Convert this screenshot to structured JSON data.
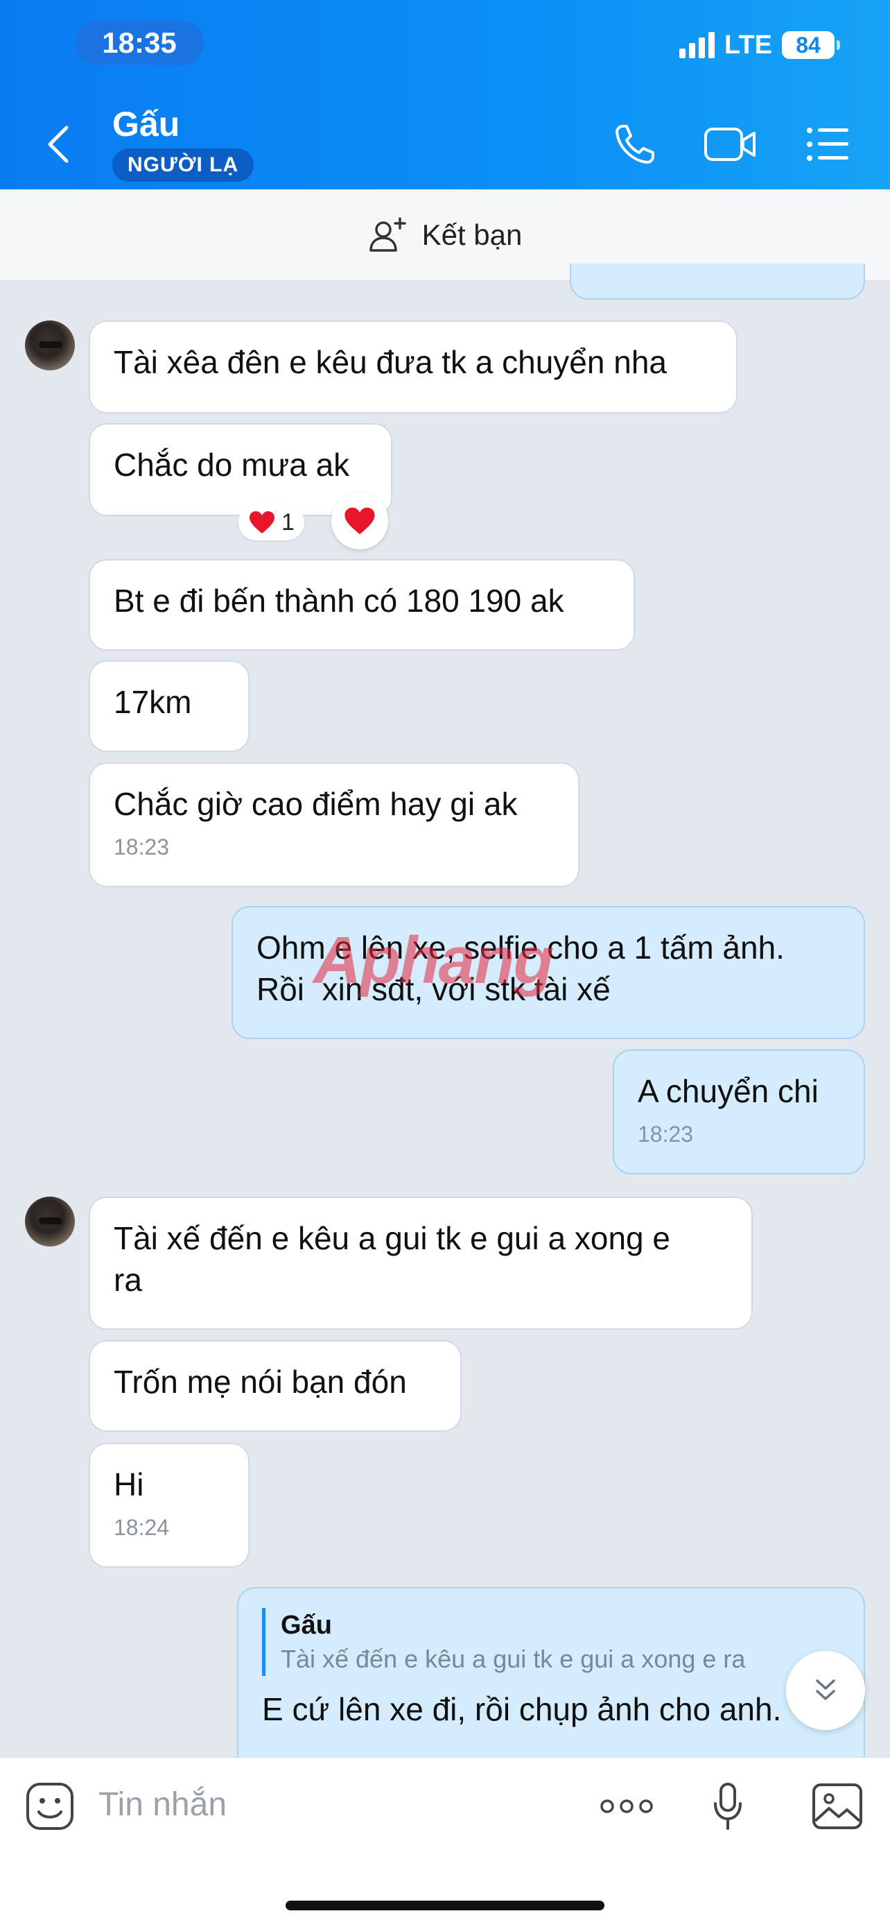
{
  "status_bar": {
    "time": "18:35",
    "network": "LTE",
    "battery": "84"
  },
  "header": {
    "contact_name": "Gấu",
    "badge": "NGƯỜI LẠ"
  },
  "friend_bar": {
    "label": "Kết bạn"
  },
  "messages": [
    {
      "text": "Tài xêa đên e kêu đưa tk a chuyển nha"
    },
    {
      "text": "Chắc do mưa ak",
      "reaction_count": "1"
    },
    {
      "text": "Bt e đi bến thành có 180 190 ak"
    },
    {
      "text": "17km"
    },
    {
      "text": "Chắc giờ cao điểm hay gi ak",
      "time": "18:23"
    },
    {
      "text": "Ohm e lên xe, selfie cho a 1 tấm ảnh.\nRồi  xin sđt, với stk tài xế"
    },
    {
      "text": "A chuyển chi",
      "time": "18:23"
    },
    {
      "text": "Tài xế đến e kêu a gui tk e gui a xong e\nra"
    },
    {
      "text": "Trốn mẹ nói bạn đón"
    },
    {
      "text": "Hi",
      "time": "18:24"
    },
    {
      "quote_name": "Gấu",
      "quote_text": "Tài xế đến e kêu a gui tk e gui a xong e ra",
      "text": "E cứ lên xe đi, rồi chụp ảnh cho anh."
    }
  ],
  "watermark": "Aphang",
  "composer": {
    "placeholder": "Tin nhắn"
  },
  "colors": {
    "header": "#0b8ff6",
    "outgoing_bubble": "#d4ecfd",
    "incoming_bubble": "#ffffff",
    "background": "#e3e8ef"
  }
}
